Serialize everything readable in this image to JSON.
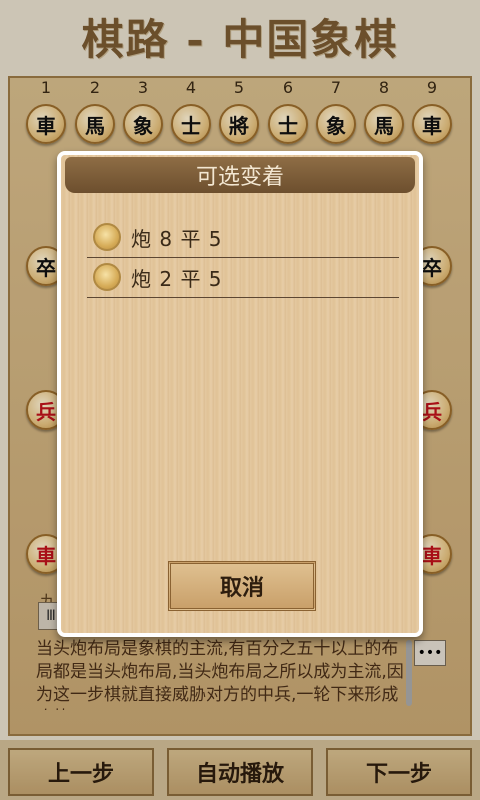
{
  "app_title": "棋路 - 中国象棋",
  "board": {
    "file_numbers": [
      "1",
      "2",
      "3",
      "4",
      "5",
      "6",
      "7",
      "8",
      "9"
    ],
    "top_pieces": [
      "車",
      "馬",
      "象",
      "士",
      "將",
      "士",
      "象",
      "馬",
      "車"
    ],
    "left_pieces": [
      "卒",
      "兵",
      "車"
    ],
    "right_pieces": [
      "卒",
      "兵",
      "車"
    ],
    "side_tag": "九",
    "side_box": "Ⅲ",
    "more_label": "•••"
  },
  "comment": "当头炮布局是象棋的主流,有百分之五十以上的布局都是当头炮布局,当头炮布局之所以成为主流,因为这一步棋就直接威胁对方的中兵,一轮下来形成攻势",
  "nav": {
    "prev": "上一步",
    "auto": "自动播放",
    "next": "下一步"
  },
  "dialog": {
    "title": "可选变着",
    "options": [
      {
        "label": "炮 8 平 5"
      },
      {
        "label": "炮 2 平 5"
      }
    ],
    "cancel": "取消"
  }
}
